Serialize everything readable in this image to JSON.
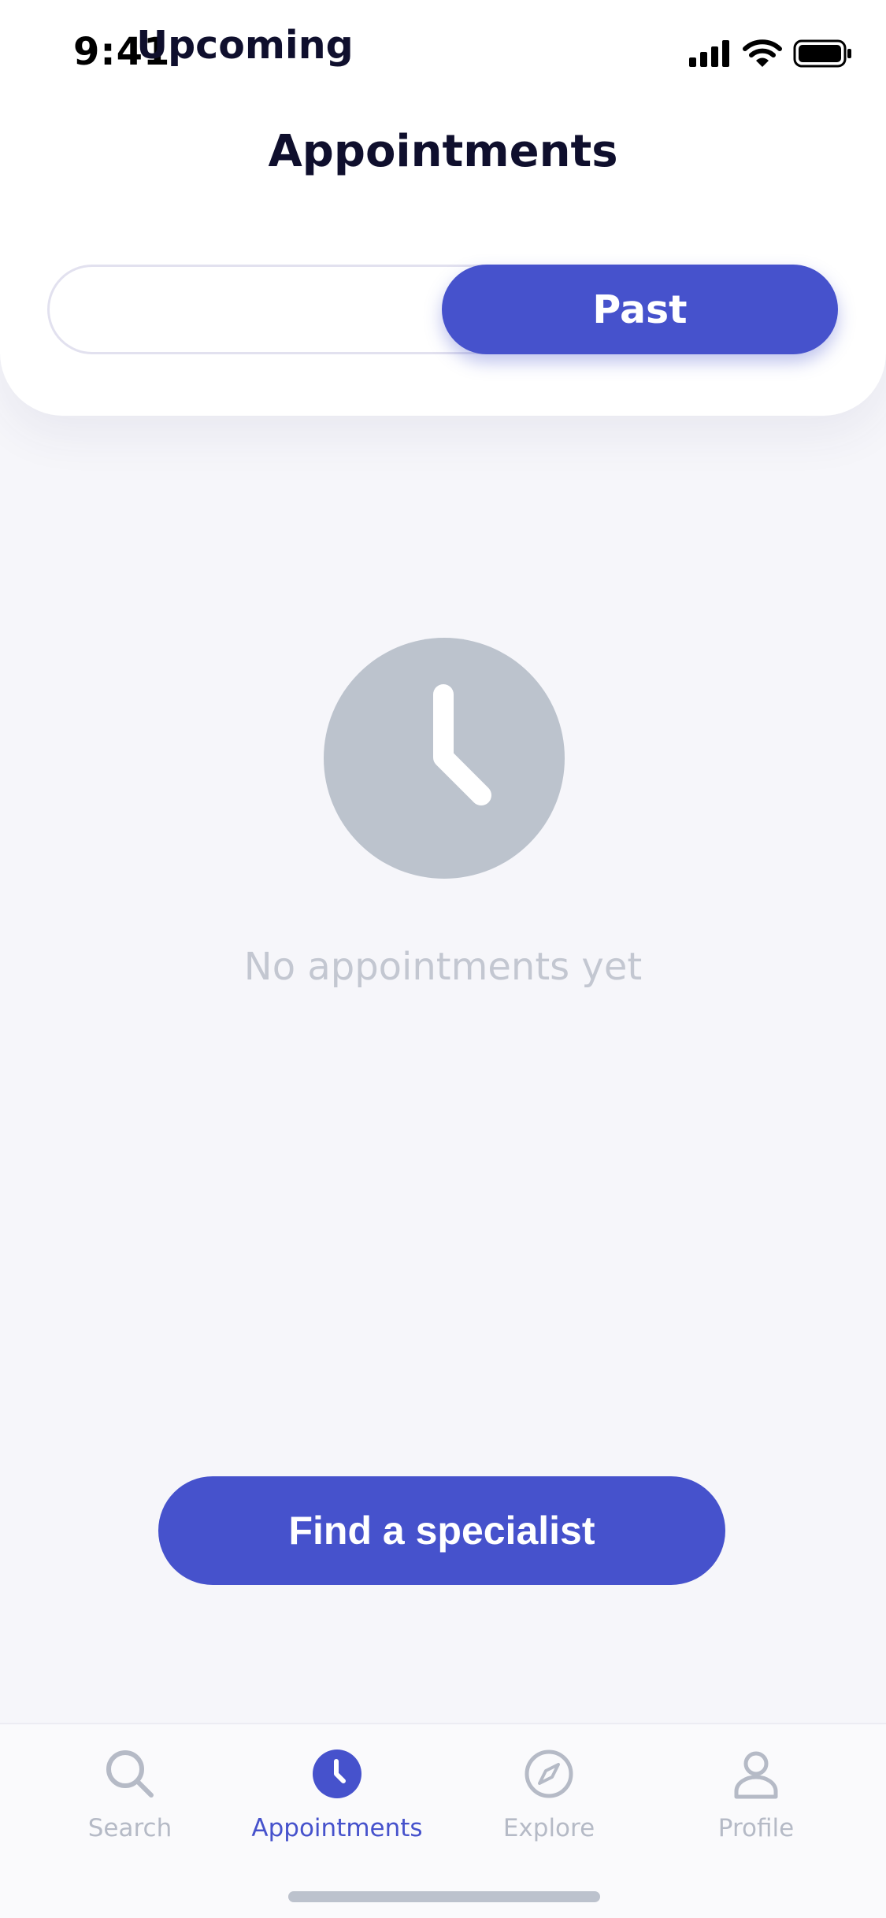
{
  "status_bar": {
    "time": "9:41"
  },
  "header": {
    "title": "Appointments"
  },
  "segmented": {
    "options": [
      "Upcoming",
      "Past"
    ],
    "selected": "Past"
  },
  "empty_state": {
    "icon": "clock-icon",
    "message": "No appointments yet"
  },
  "cta": {
    "label": "Find a specialist"
  },
  "tabbar": {
    "items": [
      {
        "label": "Search",
        "icon": "search-icon",
        "active": false
      },
      {
        "label": "Appointments",
        "icon": "clock-icon",
        "active": true
      },
      {
        "label": "Explore",
        "icon": "compass-icon",
        "active": false
      },
      {
        "label": "Profile",
        "icon": "profile-icon",
        "active": false
      }
    ]
  },
  "colors": {
    "accent": "#4652cc",
    "background": "#f6f6fa",
    "title": "#0f0f2d",
    "muted": "#b5bac6",
    "empty_icon": "#bcc3cd"
  }
}
